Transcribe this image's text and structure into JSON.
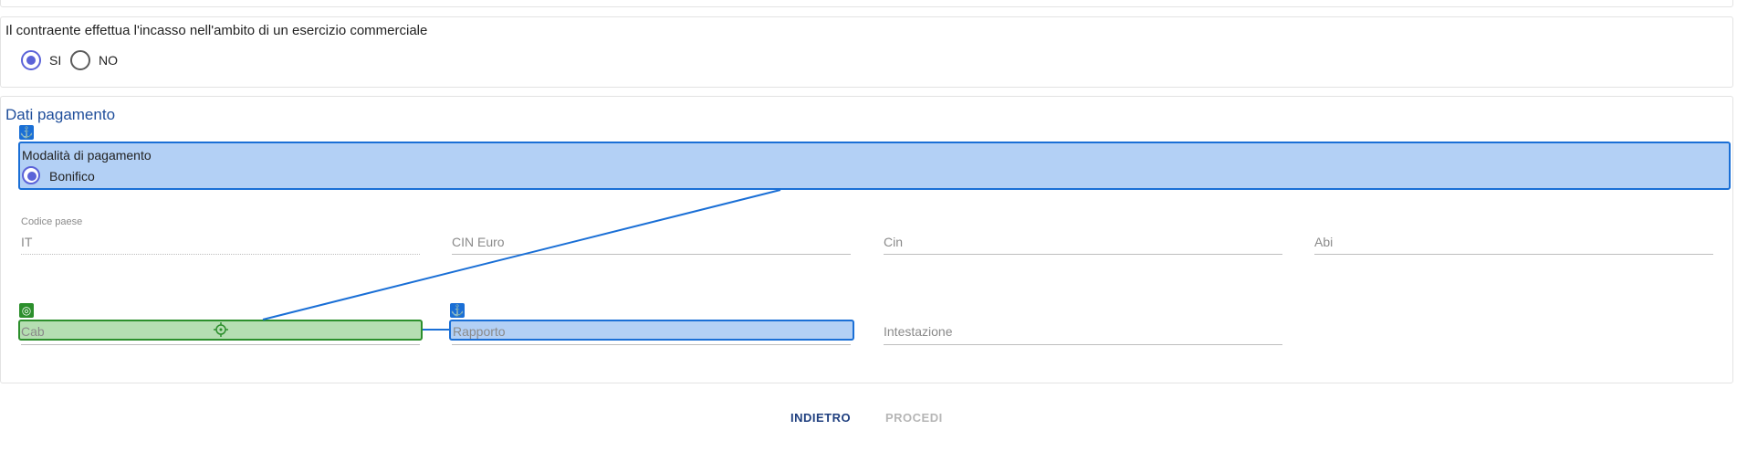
{
  "question": {
    "text": "Il contraente effettua l'incasso nell'ambito di un esercizio commerciale",
    "options": [
      {
        "label": "SI",
        "selected": true
      },
      {
        "label": "NO",
        "selected": false
      }
    ]
  },
  "payment": {
    "title": "Dati pagamento",
    "method": {
      "label": "Modalità di pagamento",
      "option": "Bonifico",
      "selected": true
    },
    "fields": {
      "codice_paese": {
        "label": "Codice paese",
        "value": "IT"
      },
      "cin_euro": {
        "placeholder": "CIN Euro"
      },
      "cin": {
        "placeholder": "Cin"
      },
      "abi": {
        "placeholder": "Abi"
      },
      "cab": {
        "placeholder": "Cab"
      },
      "rapporto": {
        "placeholder": "Rapporto"
      },
      "intestazione": {
        "placeholder": "Intestazione"
      }
    }
  },
  "actions": {
    "back_label": "INDIETRO",
    "next_label": "PROCEDI"
  },
  "colors": {
    "accent": "#5b63d8",
    "title_blue": "#1f4e9b",
    "highlight_blue": "#1a6fd6",
    "highlight_green": "#2c8f2c"
  },
  "icons": {
    "anchor": "anchor-icon",
    "target": "target-icon",
    "crosshair": "crosshair-icon"
  }
}
